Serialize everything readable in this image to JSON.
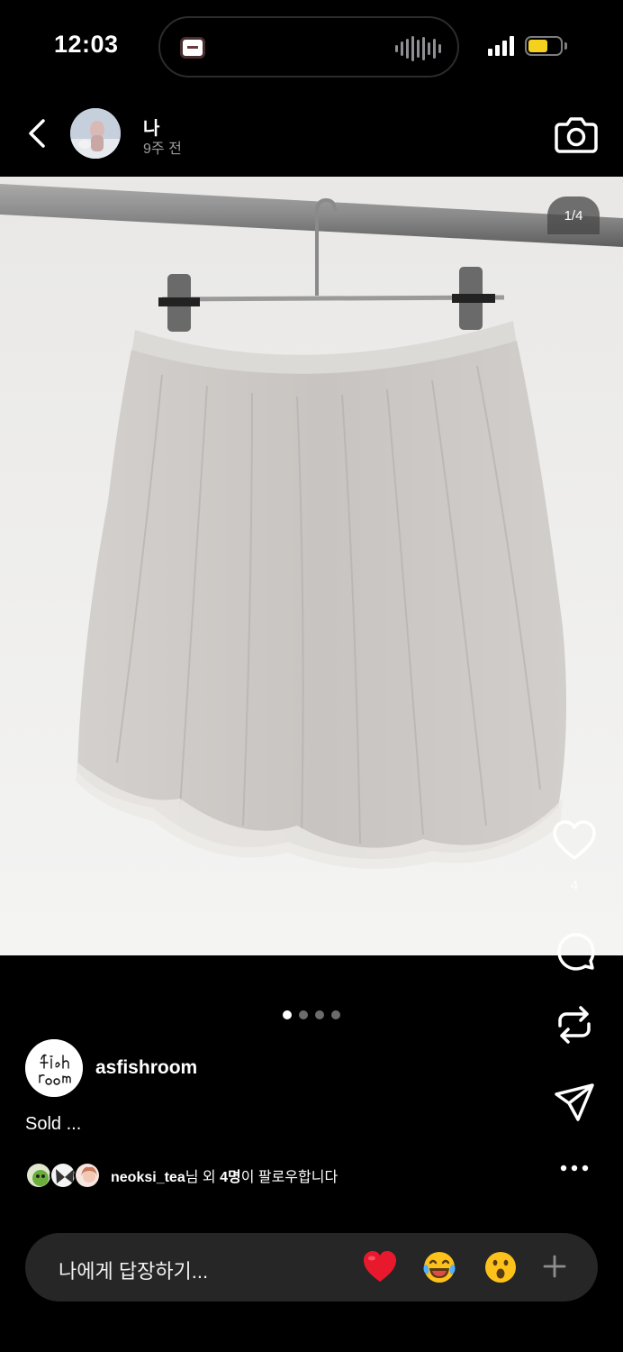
{
  "status_bar": {
    "time": "12:03",
    "battery_level": 0.62,
    "battery_color": "#f5d11e"
  },
  "header": {
    "user_name": "나",
    "post_time": "9주 전",
    "back_icon": "chevron-left-icon",
    "camera_icon": "camera-icon"
  },
  "media": {
    "page_indicator": "1/4",
    "current_page": 1,
    "total_pages": 4
  },
  "actions": {
    "like_count": "4",
    "icons": [
      "heart-icon",
      "comment-icon",
      "repost-icon",
      "send-icon",
      "more-icon"
    ]
  },
  "post": {
    "author": "asfishroom",
    "author_avatar_text": "fish room",
    "caption": "Sold ...",
    "followers": {
      "name": "neoksi_tea",
      "middle": "님 외 ",
      "count": "4명",
      "suffix": "이 팔로우합니다"
    }
  },
  "reply": {
    "placeholder": "나에게 답장하기...",
    "quick_reactions": [
      "❤️",
      "😂",
      "😮"
    ]
  },
  "colors": {
    "background": "#000000",
    "reply_bar": "#262626",
    "secondary_text": "#9a9a9a"
  }
}
